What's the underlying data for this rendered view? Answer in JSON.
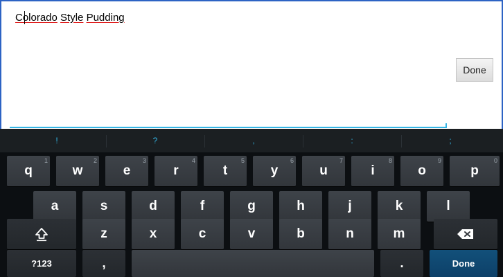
{
  "editor": {
    "words": [
      "Colorado",
      "Style",
      "Pudding"
    ],
    "separator": " ",
    "accent_color": "#33b5e5",
    "spellcheck_underline_color": "#e02020"
  },
  "side_button": {
    "label": "Done"
  },
  "keyboard": {
    "suggestions": [
      "!",
      "?",
      ",",
      ":",
      ";"
    ],
    "row1": [
      {
        "label": "q",
        "hint": "1"
      },
      {
        "label": "w",
        "hint": "2"
      },
      {
        "label": "e",
        "hint": "3"
      },
      {
        "label": "r",
        "hint": "4"
      },
      {
        "label": "t",
        "hint": "5"
      },
      {
        "label": "y",
        "hint": "6"
      },
      {
        "label": "u",
        "hint": "7"
      },
      {
        "label": "i",
        "hint": "8"
      },
      {
        "label": "o",
        "hint": "9"
      },
      {
        "label": "p",
        "hint": "0"
      }
    ],
    "row2": [
      "a",
      "s",
      "d",
      "f",
      "g",
      "h",
      "j",
      "k",
      "l"
    ],
    "row3": [
      "z",
      "x",
      "c",
      "v",
      "b",
      "n",
      "m"
    ],
    "symbols_label": "?123",
    "comma_label": ",",
    "period_label": ".",
    "done_label": "Done",
    "key_color": "#3a3f44",
    "done_color": "#0f4a73"
  }
}
